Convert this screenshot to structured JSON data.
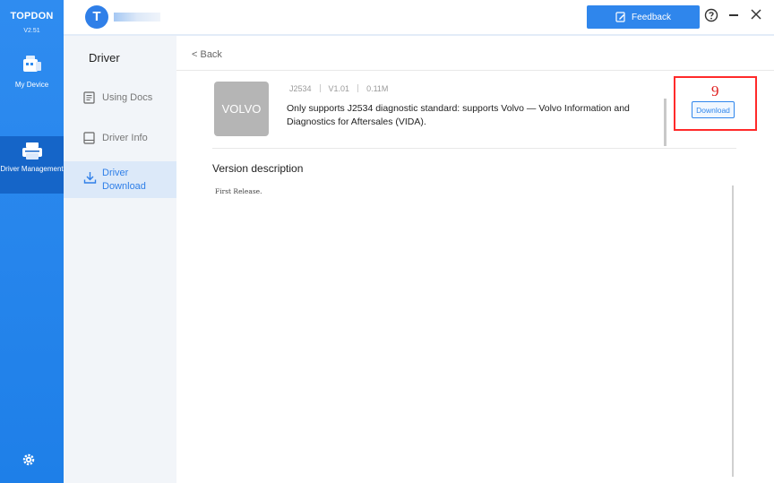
{
  "app": {
    "brand": "TOPDON",
    "version": "V2.51"
  },
  "rail": {
    "items": [
      {
        "label": "My Device",
        "icon": "device-icon"
      },
      {
        "label": "Driver Management",
        "icon": "printer-icon"
      }
    ],
    "settings_icon": "gear-icon"
  },
  "header": {
    "avatar_letter": "T",
    "feedback_label": "Feedback",
    "help_icon": "help-circle-icon",
    "minimize_icon": "minimize-icon",
    "close_icon": "close-icon"
  },
  "subnav": {
    "title": "Driver",
    "items": [
      {
        "label": "Using Docs",
        "icon": "document-icon"
      },
      {
        "label": "Driver Info",
        "icon": "info-card-icon"
      },
      {
        "label_line1": "Driver",
        "label_line2": "Download",
        "icon": "download-icon",
        "active": true
      }
    ]
  },
  "main": {
    "back_label": "< Back",
    "driver": {
      "logo_text": "VOLVO",
      "protocol": "J2534",
      "version": "V1.01",
      "size": "0.11M",
      "description": "Only supports J2534 diagnostic standard: supports Volvo — Volvo Information and Diagnostics for Aftersales (VIDA).",
      "download_label": "Download"
    },
    "annotation_number": "9",
    "version_title": "Version description",
    "version_text": "First Release."
  },
  "colors": {
    "rail_blue": "#1e7fe8",
    "accent": "#2f86ec",
    "active_bg": "#dce9f9",
    "annotation_red": "#ff2a2a"
  }
}
